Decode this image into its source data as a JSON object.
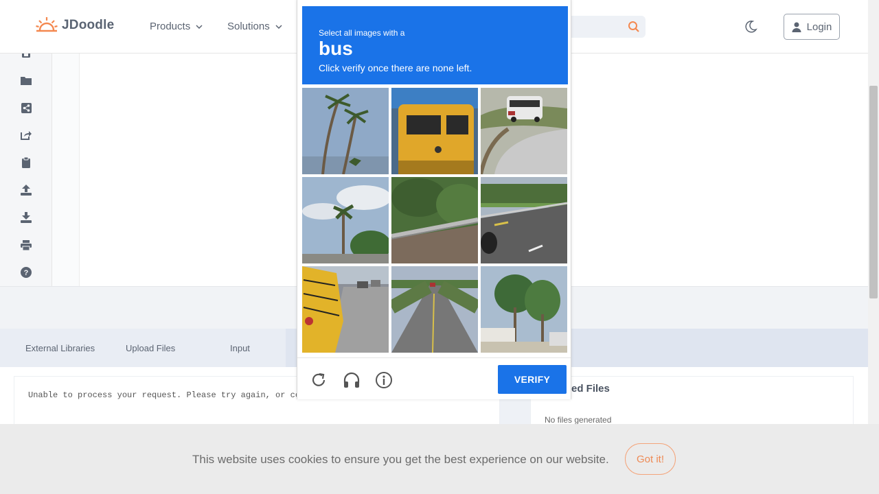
{
  "header": {
    "logo_text": "JDoodle",
    "nav": [
      {
        "label": "Products"
      },
      {
        "label": "Solutions"
      }
    ],
    "login_label": "Login"
  },
  "sidebar": {
    "icons": [
      "save-icon",
      "folder-icon",
      "share-icon",
      "external-share-icon",
      "clipboard-icon",
      "upload-icon",
      "download-icon",
      "print-icon",
      "help-icon"
    ]
  },
  "tabs": [
    {
      "label": "External Libraries"
    },
    {
      "label": "Upload Files"
    },
    {
      "label": "Input"
    }
  ],
  "output": {
    "text": "Unable to process your request. Please try again, or contact"
  },
  "generated_files": {
    "title": "ed Files",
    "empty": "No files generated"
  },
  "cookie": {
    "text": "This website uses cookies to ensure you get the best experience on our website.",
    "button": "Got it!"
  },
  "captcha": {
    "instruction_pre": "Select all images with a",
    "target": "bus",
    "instruction_post": "Click verify once there are none left.",
    "verify_label": "VERIFY",
    "tiles": [
      "palm-trees",
      "yellow-van",
      "bus-on-road",
      "palm-tree-cloudy",
      "guardrail-bushes",
      "road-guardrail",
      "school-bus",
      "road-straight",
      "trees-houses"
    ]
  },
  "colors": {
    "captcha_blue": "#1a73e8",
    "accent_orange": "#f4a47a"
  }
}
